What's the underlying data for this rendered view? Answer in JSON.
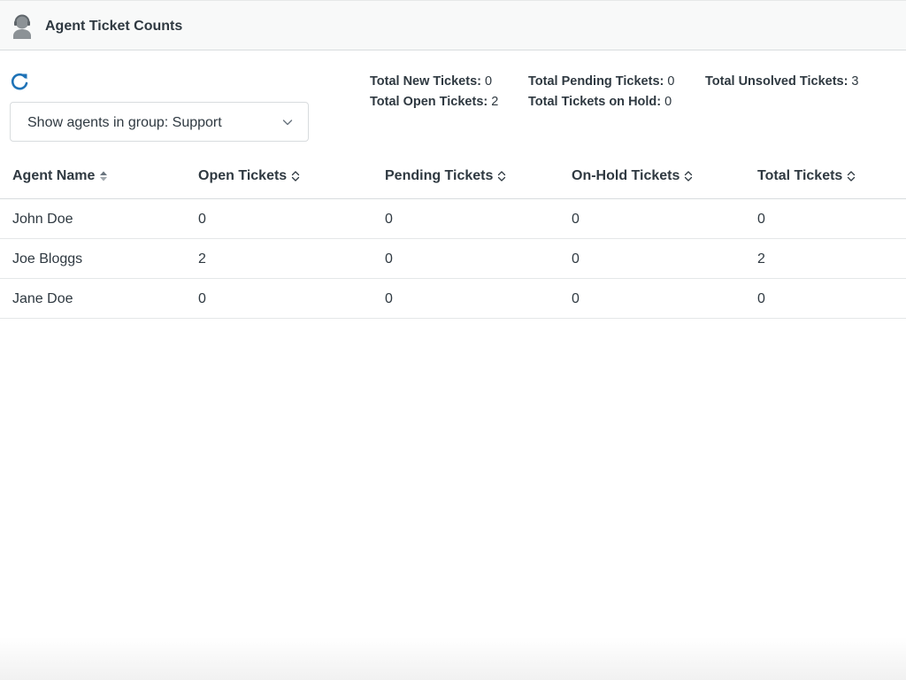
{
  "app": {
    "title": "Agent Ticket Counts",
    "icon": "agent-headset-icon",
    "colors": {
      "accent": "#1f73b7",
      "text": "#2f3941",
      "header_bg": "#f8f9f9",
      "border": "#d8dcde"
    }
  },
  "toolbar": {
    "refresh_icon": "refresh-icon",
    "group_select": {
      "value": "Show agents in group: Support",
      "icon": "chevron-down-icon"
    }
  },
  "stats": [
    {
      "label": "Total New Tickets:",
      "value": "0"
    },
    {
      "label": "Total Open Tickets:",
      "value": "2"
    },
    {
      "label": "Total Pending Tickets:",
      "value": "0"
    },
    {
      "label": "Total Tickets on Hold:",
      "value": "0"
    },
    {
      "label": "Total Unsolved Tickets:",
      "value": "3"
    }
  ],
  "table": {
    "columns": [
      {
        "label": "Agent Name",
        "sort": "sorted"
      },
      {
        "label": "Open Tickets",
        "sort": "sortable"
      },
      {
        "label": "Pending Tickets",
        "sort": "sortable"
      },
      {
        "label": "On-Hold Tickets",
        "sort": "sortable"
      },
      {
        "label": "Total Tickets",
        "sort": "sortable"
      }
    ],
    "rows": [
      [
        "John Doe",
        "0",
        "0",
        "0",
        "0"
      ],
      [
        "Joe Bloggs",
        "2",
        "0",
        "0",
        "2"
      ],
      [
        "Jane Doe",
        "0",
        "0",
        "0",
        "0"
      ]
    ]
  }
}
